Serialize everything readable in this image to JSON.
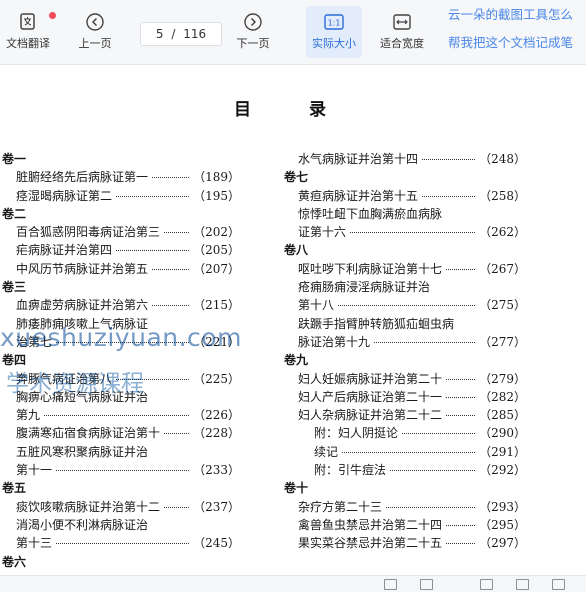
{
  "toolbar": {
    "translate_label": "文档翻译",
    "prev_label": "上一页",
    "current_page": "5",
    "page_sep": "/",
    "total_pages": "116",
    "next_label": "下一页",
    "actual_size_label": "实际大小",
    "actual_size_icon_text": "1:1",
    "fit_width_label": "适合宽度"
  },
  "banner": {
    "line1": "云一朵的截图工具怎么",
    "line2": "帮我把这个文档记成笔"
  },
  "document": {
    "title": "目 录",
    "left": [
      {
        "text": "卷一",
        "page": "",
        "kind": "sec"
      },
      {
        "text": "脏腑经络先后病脉证第一",
        "page": "（189）",
        "kind": "item"
      },
      {
        "text": "痉湿暍病脉证第二",
        "page": "（195）",
        "kind": "item"
      },
      {
        "text": "卷二",
        "page": "",
        "kind": "sec"
      },
      {
        "text": "百合狐惑阴阳毒病证治第三",
        "page": "（202）",
        "kind": "item"
      },
      {
        "text": "疟病脉证并治第四",
        "page": "（205）",
        "kind": "item"
      },
      {
        "text": "中风历节病脉证并治第五",
        "page": "（207）",
        "kind": "item"
      },
      {
        "text": "卷三",
        "page": "",
        "kind": "sec"
      },
      {
        "text": "血痹虚劳病脉证并治第六",
        "page": "（215）",
        "kind": "item"
      },
      {
        "text": "肺痿肺痈咳嗽上气病脉证",
        "page": "",
        "kind": "item"
      },
      {
        "text": "治第七",
        "page": "（221）",
        "kind": "item"
      },
      {
        "text": "卷四",
        "page": "",
        "kind": "sec"
      },
      {
        "text": "奔豚气病证治第八",
        "page": "（225）",
        "kind": "item"
      },
      {
        "text": "胸痹心痛短气病脉证并治",
        "page": "",
        "kind": "item"
      },
      {
        "text": "第九",
        "page": "（226）",
        "kind": "item"
      },
      {
        "text": "腹满寒疝宿食病脉证治第十",
        "page": "（228）",
        "kind": "item"
      },
      {
        "text": "五脏风寒积聚病脉证并治",
        "page": "",
        "kind": "item"
      },
      {
        "text": "第十一",
        "page": "（233）",
        "kind": "item"
      },
      {
        "text": "卷五",
        "page": "",
        "kind": "sec"
      },
      {
        "text": "痰饮咳嗽病脉证并治第十二",
        "page": "（237）",
        "kind": "item"
      },
      {
        "text": "消渴小便不利淋病脉证治",
        "page": "",
        "kind": "item"
      },
      {
        "text": "第十三",
        "page": "（245）",
        "kind": "item"
      },
      {
        "text": "卷六",
        "page": "",
        "kind": "sec"
      }
    ],
    "right": [
      {
        "text": "水气病脉证并治第十四",
        "page": "（248）",
        "kind": "item"
      },
      {
        "text": "卷七",
        "page": "",
        "kind": "sec"
      },
      {
        "text": "黄疸病脉证并治第十五",
        "page": "（258）",
        "kind": "item"
      },
      {
        "text": "惊悸吐衄下血胸满瘀血病脉",
        "page": "",
        "kind": "item"
      },
      {
        "text": "证第十六",
        "page": "（262）",
        "kind": "item"
      },
      {
        "text": "卷八",
        "page": "",
        "kind": "sec"
      },
      {
        "text": "呕吐哕下利病脉证治第十七",
        "page": "（267）",
        "kind": "item"
      },
      {
        "text": "疮痈肠痈浸淫病脉证并治",
        "page": "",
        "kind": "item"
      },
      {
        "text": "第十八",
        "page": "（275）",
        "kind": "item"
      },
      {
        "text": "趺蹶手指臂肿转筋狐疝蛔虫病",
        "page": "",
        "kind": "item"
      },
      {
        "text": "脉证治第十九",
        "page": "（277）",
        "kind": "item"
      },
      {
        "text": "卷九",
        "page": "",
        "kind": "sec"
      },
      {
        "text": "妇人妊娠病脉证并治第二十",
        "page": "（279）",
        "kind": "item"
      },
      {
        "text": "妇人产后病脉证治第二十一",
        "page": "（282）",
        "kind": "item"
      },
      {
        "text": "妇人杂病脉证并治第二十二",
        "page": "（285）",
        "kind": "item"
      },
      {
        "text": "附：妇人阴挺论",
        "page": "（290）",
        "kind": "sub"
      },
      {
        "text": "续记",
        "page": "（291）",
        "kind": "sub"
      },
      {
        "text": "附：引牛痘法",
        "page": "（292）",
        "kind": "sub"
      },
      {
        "text": "卷十",
        "page": "",
        "kind": "sec"
      },
      {
        "text": "杂疗方第二十三",
        "page": "（293）",
        "kind": "item"
      },
      {
        "text": "禽兽鱼虫禁忌并治第二十四",
        "page": "（295）",
        "kind": "item"
      },
      {
        "text": "果实菜谷禁忌并治第二十五",
        "page": "（297）",
        "kind": "item"
      }
    ]
  },
  "watermark": {
    "line1": "xueshuziyuan.com",
    "line2": "学术资源课程"
  },
  "colors": {
    "accent": "#2a6cd6",
    "badge": "#f04a5b",
    "banner_text": "#4a86e8"
  }
}
